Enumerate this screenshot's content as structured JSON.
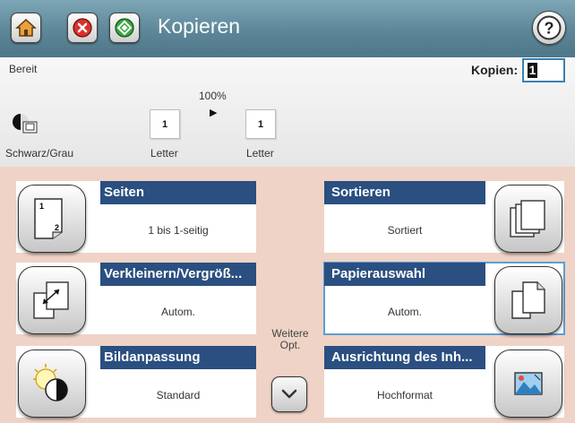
{
  "titlebar": {
    "title": "Kopieren",
    "home_icon": "home-icon",
    "stop_icon": "stop-icon",
    "start_icon": "start-icon",
    "help_icon": "help-icon"
  },
  "status": {
    "text": "Bereit",
    "copies_label": "Kopien:",
    "copies_value": "1"
  },
  "preview": {
    "color_mode": "Schwarz/Grau",
    "zoom": "100%",
    "source_count": "1",
    "source_label": "Letter",
    "dest_count": "1",
    "dest_label": "Letter"
  },
  "options": {
    "sides": {
      "title": "Seiten",
      "value": "1 bis 1-seitig"
    },
    "collate": {
      "title": "Sortieren",
      "value": "Sortiert"
    },
    "reduce": {
      "title": "Verkleinern/Vergröß...",
      "value": "Autom."
    },
    "paper": {
      "title": "Papierauswahl",
      "value": "Autom."
    },
    "image_adjust": {
      "title": "Bildanpassung",
      "value": "Standard"
    },
    "orientation": {
      "title": "Ausrichtung des Inh...",
      "value": "Hochformat"
    }
  },
  "more": {
    "label": "Weitere Opt."
  },
  "colors": {
    "titlebar": "#5d8799",
    "tile_header": "#2a4f80",
    "options_bg": "#efd3c6",
    "selected_outline": "#5b9ed6"
  }
}
